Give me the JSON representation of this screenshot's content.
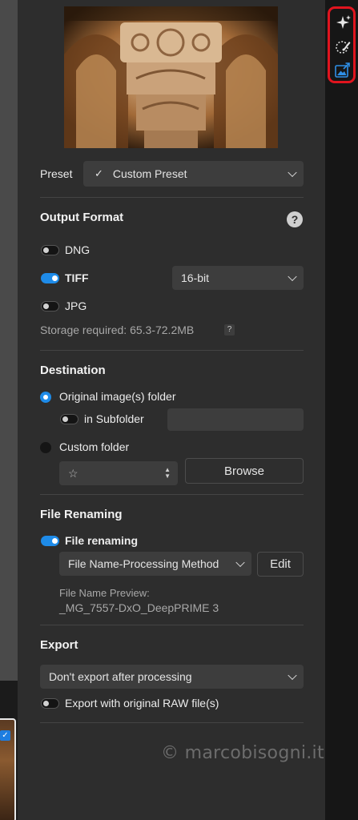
{
  "preset": {
    "label": "Preset",
    "value": "Custom Preset",
    "check_mark": "✓"
  },
  "output_format": {
    "title": "Output Format",
    "help": "?",
    "dng": {
      "label": "DNG",
      "on": false
    },
    "tiff": {
      "label": "TIFF",
      "on": true,
      "bit_depth": "16-bit"
    },
    "jpg": {
      "label": "JPG",
      "on": false
    },
    "storage": "Storage required: 65.3-72.2MB",
    "storage_help": "?"
  },
  "destination": {
    "title": "Destination",
    "original_folder": "Original image(s) folder",
    "subfolder": "in Subfolder",
    "subfolder_value": "",
    "custom_folder": "Custom folder",
    "folder_select_value": "☆",
    "browse": "Browse"
  },
  "file_renaming": {
    "title": "File Renaming",
    "toggle_label": "File renaming",
    "method": "File Name-Processing Method",
    "edit": "Edit",
    "preview_label": "File Name Preview:",
    "preview_value": "_MG_7557-DxO_DeepPRIME 3"
  },
  "export": {
    "title": "Export",
    "option": "Don't export after processing",
    "raw_toggle": "Export with original RAW file(s)"
  },
  "watermark": "© marcobisogni.it",
  "thumbnail_check": "✓",
  "colors": {
    "accent": "#1e8be8",
    "highlight": "#e0141e",
    "panel": "#2d2d2d"
  },
  "icons": [
    "sparkle-icon",
    "magic-brush-icon",
    "export-image-icon",
    "chevron-down-icon",
    "help-icon"
  ]
}
